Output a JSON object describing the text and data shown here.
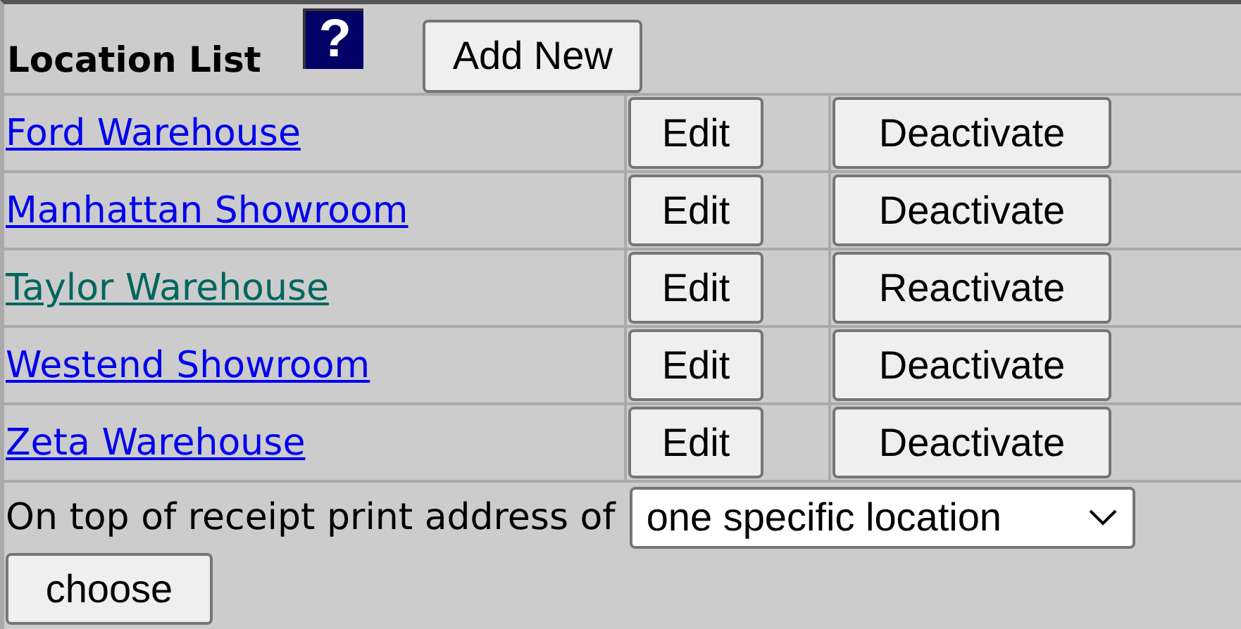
{
  "header": {
    "title": "Location List",
    "help_icon": "?",
    "add_button": "Add New"
  },
  "locations": [
    {
      "name": "Ford Warehouse",
      "active": true,
      "edit": "Edit",
      "toggle": "Deactivate"
    },
    {
      "name": "Manhattan Showroom",
      "active": true,
      "edit": "Edit",
      "toggle": "Deactivate"
    },
    {
      "name": "Taylor Warehouse",
      "active": false,
      "edit": "Edit",
      "toggle": "Reactivate"
    },
    {
      "name": "Westend Showroom",
      "active": true,
      "edit": "Edit",
      "toggle": "Deactivate"
    },
    {
      "name": "Zeta Warehouse",
      "active": true,
      "edit": "Edit",
      "toggle": "Deactivate"
    }
  ],
  "receipt": {
    "label": "On top of receipt print address of",
    "select_value": "one specific location",
    "button": "choose"
  }
}
